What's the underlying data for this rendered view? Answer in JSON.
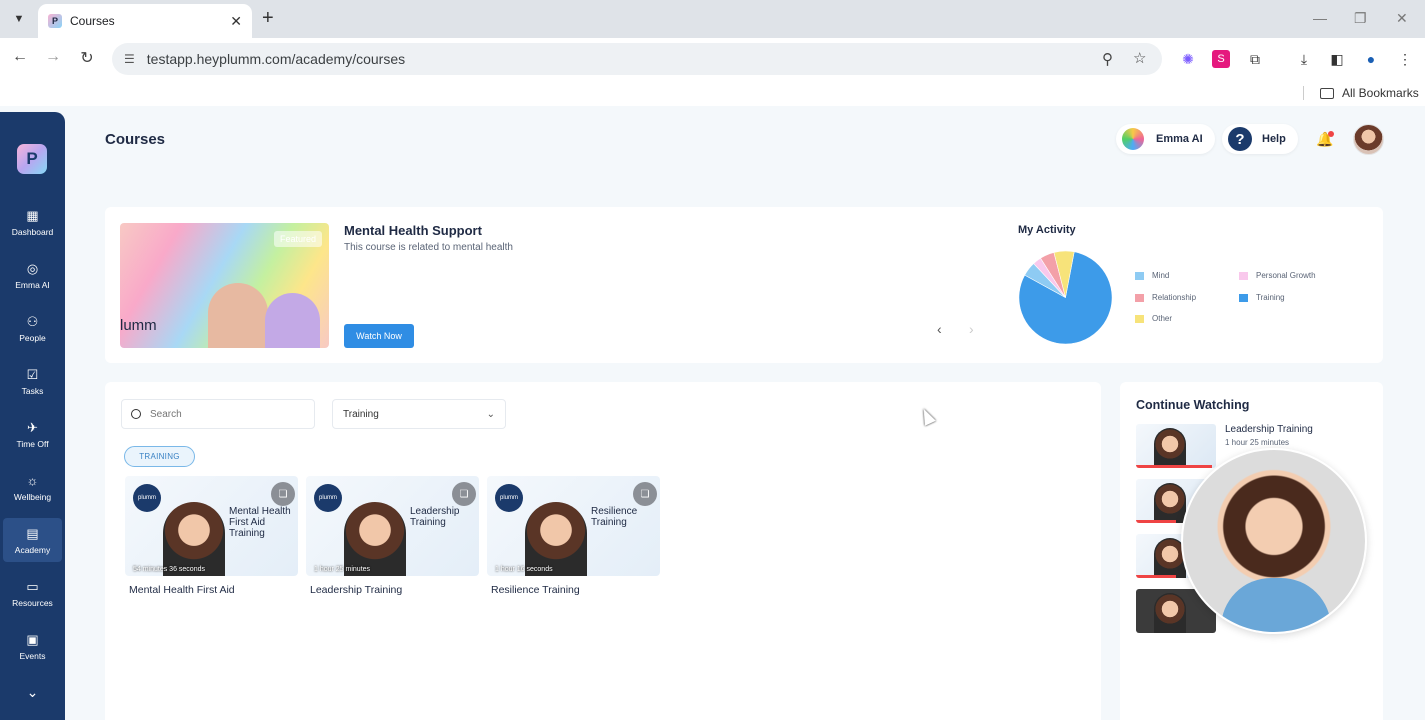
{
  "browser": {
    "tab_title": "Courses",
    "url": "testapp.heyplumm.com/academy/courses",
    "bookmarks_label": "All Bookmarks"
  },
  "sidebar": {
    "logo_letter": "P",
    "items": [
      {
        "label": "Dashboard",
        "icon": "grid-icon"
      },
      {
        "label": "Emma AI",
        "icon": "chat-icon"
      },
      {
        "label": "People",
        "icon": "people-icon"
      },
      {
        "label": "Tasks",
        "icon": "tasks-icon"
      },
      {
        "label": "Time Off",
        "icon": "plane-icon"
      },
      {
        "label": "Wellbeing",
        "icon": "sun-icon"
      },
      {
        "label": "Academy",
        "icon": "book-icon",
        "active": true
      },
      {
        "label": "Resources",
        "icon": "folder-icon"
      },
      {
        "label": "Events",
        "icon": "calendar-icon"
      }
    ]
  },
  "header": {
    "title": "Courses",
    "emma_label": "Emma AI",
    "help_label": "Help"
  },
  "featured": {
    "badge": "Featured",
    "brand": "lumm",
    "title": "Mental Health Support",
    "description": "This course is related to mental health",
    "button": "Watch Now"
  },
  "activity": {
    "title": "My Activity",
    "legend": [
      {
        "label": "Mind",
        "color": "#8ecbf3"
      },
      {
        "label": "Personal Growth",
        "color": "#f9c8ec"
      },
      {
        "label": "Relationship",
        "color": "#f3a0a8"
      },
      {
        "label": "Training",
        "color": "#3d9be9"
      },
      {
        "label": "Other",
        "color": "#f7e37a"
      }
    ]
  },
  "chart_data": {
    "type": "pie",
    "title": "My Activity",
    "categories": [
      "Training",
      "Mind",
      "Personal Growth",
      "Relationship",
      "Other"
    ],
    "values": [
      80,
      5,
      3,
      5,
      7
    ],
    "colors": [
      "#3d9be9",
      "#8ecbf3",
      "#f9c8ec",
      "#f3a0a8",
      "#f7e37a"
    ]
  },
  "filters": {
    "search_placeholder": "Search",
    "category": "Training",
    "chip": "TRAINING"
  },
  "courses": [
    {
      "name": "Mental Health First Aid",
      "thumb_title": "Mental Health First Aid Training",
      "duration": "54 minutes 36 seconds"
    },
    {
      "name": "Leadership Training",
      "thumb_title": "Leadership Training",
      "duration": "1 hour 25 minutes"
    },
    {
      "name": "Resilience Training",
      "thumb_title": "Resilience Training",
      "duration": "1 hour 16 seconds"
    }
  ],
  "continue_watching": {
    "title": "Continue Watching",
    "items": [
      {
        "name": "Leadership Training",
        "duration": "1 hour 25 minutes",
        "progress": 0.95
      }
    ]
  }
}
